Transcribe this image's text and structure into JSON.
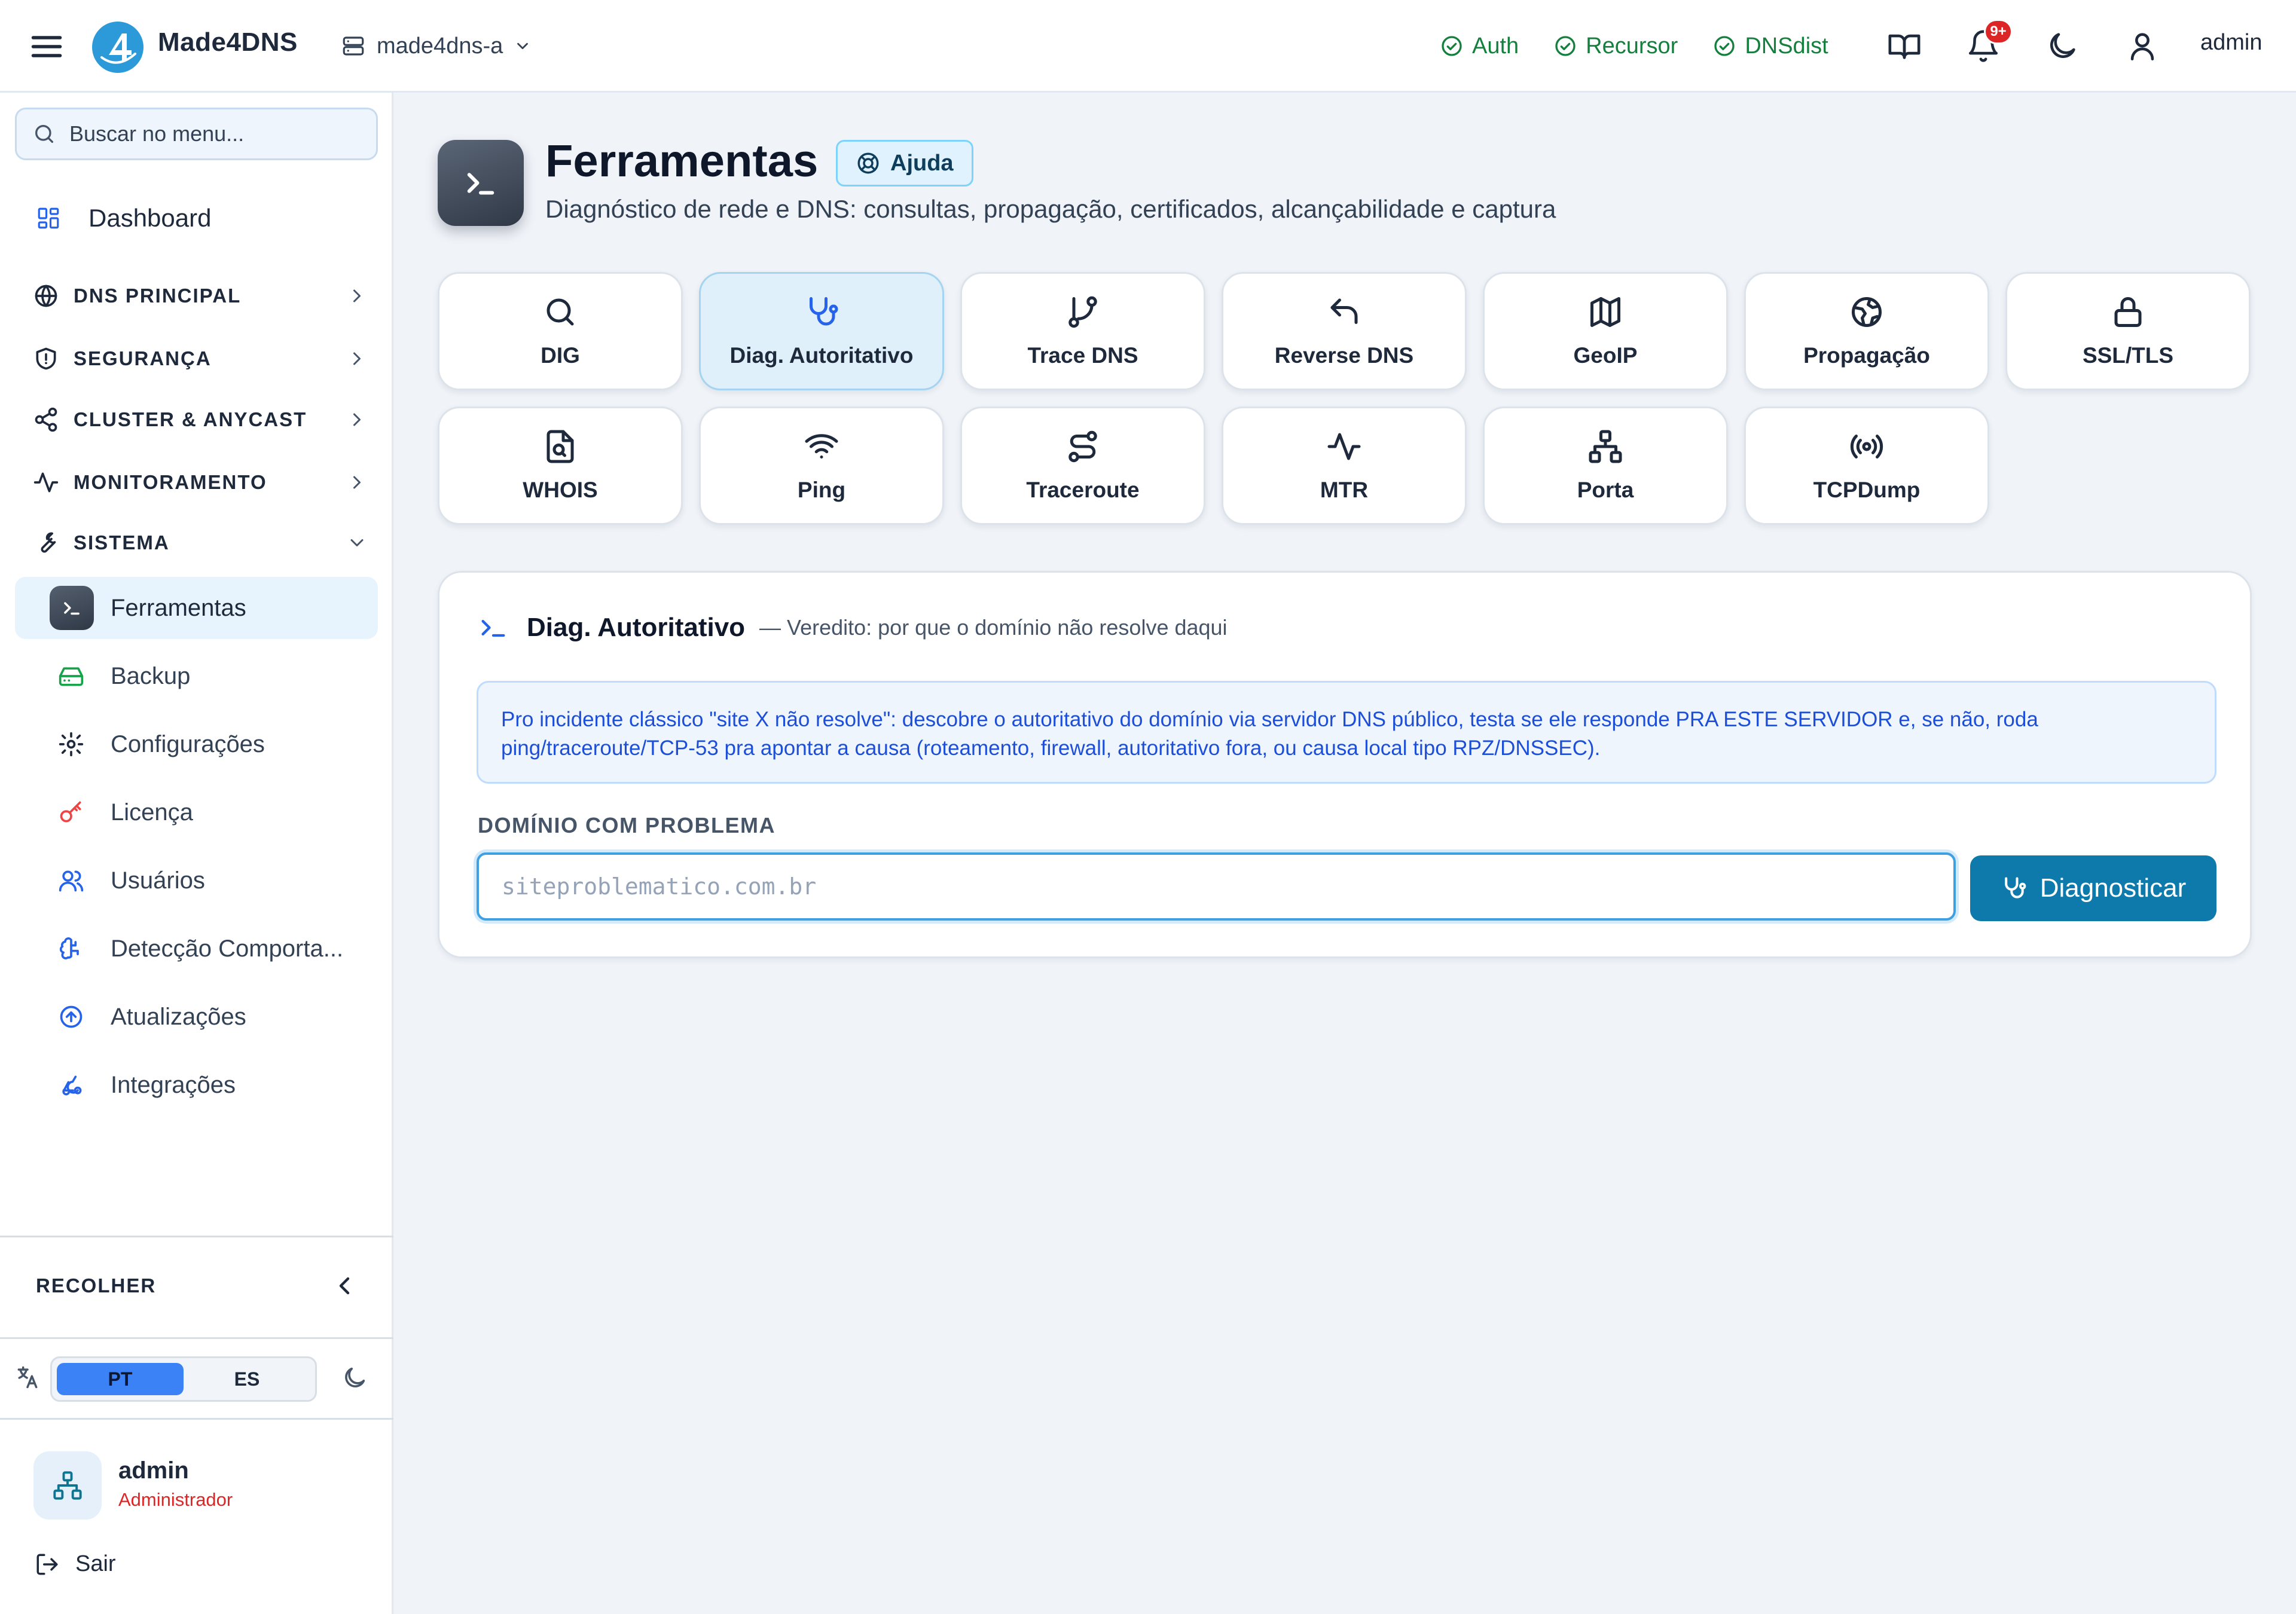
{
  "topbar": {
    "brand": "Made4DNS",
    "server": "made4dns-a",
    "services": [
      {
        "label": "Auth"
      },
      {
        "label": "Recursor"
      },
      {
        "label": "DNSdist"
      }
    ],
    "notifications_badge": "9+",
    "user": "admin"
  },
  "sidebar": {
    "search_placeholder": "Buscar no menu...",
    "dashboard": "Dashboard",
    "sections": [
      {
        "label": "DNS PRINCIPAL"
      },
      {
        "label": "SEGURANÇA"
      },
      {
        "label": "CLUSTER & ANYCAST"
      },
      {
        "label": "MONITORAMENTO"
      },
      {
        "label": "SISTEMA"
      }
    ],
    "items": [
      {
        "label": "Ferramentas"
      },
      {
        "label": "Backup"
      },
      {
        "label": "Configurações"
      },
      {
        "label": "Licença"
      },
      {
        "label": "Usuários"
      },
      {
        "label": "Detecção Comporta..."
      },
      {
        "label": "Atualizações"
      },
      {
        "label": "Integrações"
      }
    ],
    "collapse_label": "RECOLHER",
    "languages": [
      "PT",
      "ES"
    ],
    "selected_language": "PT",
    "user_name": "admin",
    "user_role": "Administrador",
    "logout": "Sair"
  },
  "page": {
    "title": "Ferramentas",
    "help": "Ajuda",
    "subtitle": "Diagnóstico de rede e DNS: consultas, propagação, certificados, alcançabilidade e captura"
  },
  "tools": [
    {
      "label": "DIG",
      "icon": "search-icon"
    },
    {
      "label": "Diag. Autoritativo",
      "icon": "stethoscope-icon"
    },
    {
      "label": "Trace DNS",
      "icon": "git-branch-icon"
    },
    {
      "label": "Reverse DNS",
      "icon": "undo-arrow-icon"
    },
    {
      "label": "GeoIP",
      "icon": "map-icon"
    },
    {
      "label": "Propagação",
      "icon": "globe-icon"
    },
    {
      "label": "SSL/TLS",
      "icon": "lock-icon"
    },
    {
      "label": "WHOIS",
      "icon": "file-search-icon"
    },
    {
      "label": "Ping",
      "icon": "wifi-icon"
    },
    {
      "label": "Traceroute",
      "icon": "route-icon"
    },
    {
      "label": "MTR",
      "icon": "activity-icon"
    },
    {
      "label": "Porta",
      "icon": "network-icon"
    },
    {
      "label": "TCPDump",
      "icon": "radio-icon"
    }
  ],
  "active_tool": "Diag. Autoritativo",
  "panel": {
    "title": "Diag. Autoritativo",
    "verdict": "— Veredito: por que o domínio não resolve daqui",
    "info": "Pro incidente clássico \"site X não resolve\": descobre o autoritativo do domínio via servidor DNS público, testa se ele responde PRA ESTE SERVIDOR e, se não, roda ping/traceroute/TCP-53 pra apontar a causa (roteamento, firewall, autoritativo fora, ou causa local tipo RPZ/DNSSEC).",
    "field_label": "DOMÍNIO COM PROBLEMA",
    "input_value": "",
    "input_placeholder": "siteproblematico.com.br",
    "button": "Diagnosticar"
  },
  "colors": {
    "accent": "#0e7aab",
    "status_ok": "#15803d",
    "badge": "#dc2626",
    "info_text": "#1d4ed8"
  }
}
